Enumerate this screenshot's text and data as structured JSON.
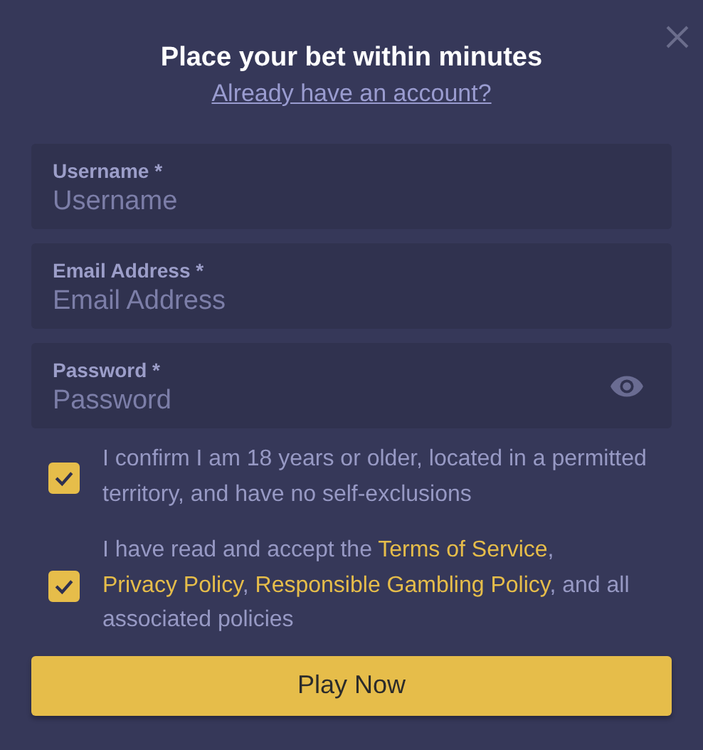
{
  "title": "Place your bet within minutes",
  "login_link": "Already have an account?",
  "fields": [
    {
      "label": "Username *",
      "placeholder": "Username",
      "kind": "text"
    },
    {
      "label": "Email Address *",
      "placeholder": "Email Address",
      "kind": "text"
    },
    {
      "label": "Password *",
      "placeholder": "Password",
      "kind": "password"
    }
  ],
  "consents": [
    {
      "checked": true,
      "parts": [
        {
          "kind": "text",
          "text": "I confirm I am 18 years or older, located in a permitted territory, and have no self-exclusions"
        }
      ]
    },
    {
      "checked": true,
      "parts": [
        {
          "kind": "text",
          "text": "I have read and accept the "
        },
        {
          "kind": "link",
          "text": "Terms of Service"
        },
        {
          "kind": "text",
          "text": ", "
        },
        {
          "kind": "link",
          "text": "Privacy Policy"
        },
        {
          "kind": "text",
          "text": ", "
        },
        {
          "kind": "link",
          "text": "Responsible Gambling Policy"
        },
        {
          "kind": "text",
          "text": ", and all associated policies"
        }
      ]
    }
  ],
  "submit": "Play Now"
}
